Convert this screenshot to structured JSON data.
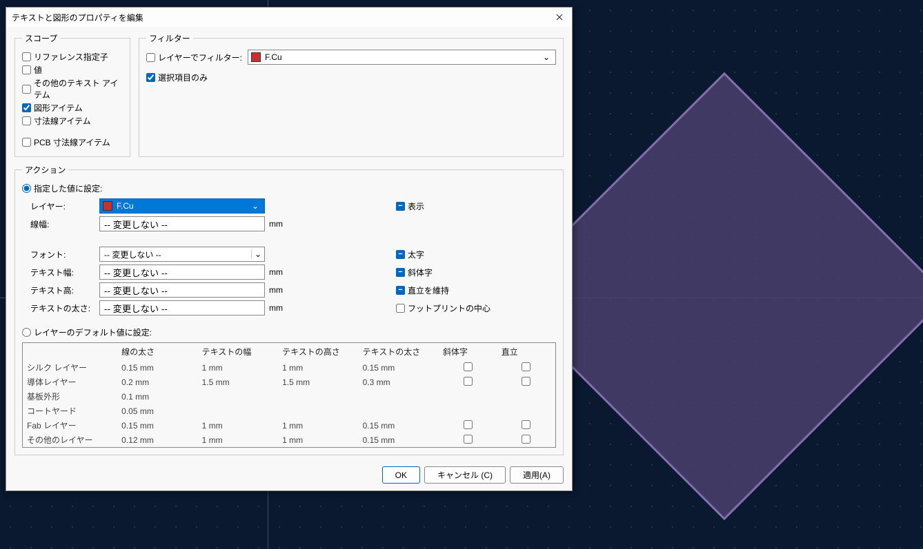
{
  "dialog": {
    "title": "テキストと図形のプロパティを編集"
  },
  "scope": {
    "legend": "スコープ",
    "items": [
      {
        "label": "リファレンス指定子",
        "checked": false
      },
      {
        "label": "値",
        "checked": false
      },
      {
        "label": "その他のテキスト アイテム",
        "checked": false
      },
      {
        "label": "図形アイテム",
        "checked": true
      },
      {
        "label": "寸法線アイテム",
        "checked": false
      },
      {
        "label": "PCB 寸法線アイテム",
        "checked": false
      }
    ]
  },
  "filter": {
    "legend": "フィルター",
    "layer_filter_label": "レイヤーでフィルター:",
    "layer_value": "F.Cu",
    "selection_only_label": "選択項目のみ",
    "selection_only_checked": true
  },
  "actions": {
    "legend": "アクション",
    "set_specified_label": "指定した値に設定:",
    "fields": {
      "layer_label": "レイヤー:",
      "layer_value": "F.Cu",
      "linewidth_label": "線幅:",
      "no_change": "-- 変更しない --",
      "font_label": "フォント:",
      "textwidth_label": "テキスト幅:",
      "textheight_label": "テキスト高:",
      "textthickness_label": "テキストの太さ:",
      "unit": "mm",
      "visible_label": "表示",
      "bold_label": "太字",
      "italic_label": "斜体字",
      "keep_upright_label": "直立を維持",
      "center_fp_label": "フットプリントの中心"
    },
    "set_defaults_label": "レイヤーのデフォルト値に設定:"
  },
  "defaults_table": {
    "headers": [
      "",
      "線の太さ",
      "テキストの幅",
      "テキストの高さ",
      "テキストの太さ",
      "斜体字",
      "直立"
    ],
    "rows": [
      {
        "name": "シルク レイヤー",
        "a": "0.15 mm",
        "b": "1 mm",
        "c": "1 mm",
        "d": "0.15 mm",
        "italic": false,
        "upright": false
      },
      {
        "name": "導体レイヤー",
        "a": "0.2 mm",
        "b": "1.5 mm",
        "c": "1.5 mm",
        "d": "0.3 mm",
        "italic": false,
        "upright": false
      },
      {
        "name": "基板外形",
        "a": "0.1 mm",
        "b": "",
        "c": "",
        "d": "",
        "italic": null,
        "upright": null
      },
      {
        "name": "コートヤード",
        "a": "0.05 mm",
        "b": "",
        "c": "",
        "d": "",
        "italic": null,
        "upright": null
      },
      {
        "name": "Fab レイヤー",
        "a": "0.15 mm",
        "b": "1 mm",
        "c": "1 mm",
        "d": "0.15 mm",
        "italic": false,
        "upright": false
      },
      {
        "name": "その他のレイヤー",
        "a": "0.12 mm",
        "b": "1 mm",
        "c": "1 mm",
        "d": "0.15 mm",
        "italic": false,
        "upright": false
      }
    ]
  },
  "buttons": {
    "ok": "OK",
    "cancel": "キャンセル (C)",
    "apply": "適用(A)"
  }
}
